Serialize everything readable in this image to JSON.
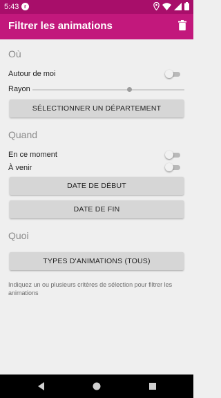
{
  "status_bar": {
    "time": "5:43",
    "icons": [
      "app-notification-icon",
      "location-icon",
      "wifi-icon",
      "signal-icon",
      "battery-icon"
    ]
  },
  "app_bar": {
    "title": "Filtrer les animations",
    "action_icon": "trash-icon"
  },
  "where": {
    "heading": "Où",
    "around_me_label": "Autour de moi",
    "around_me_on": false,
    "radius_label": "Rayon",
    "radius_value_fraction": 0.64,
    "department_button": "Sélectionner un département"
  },
  "when": {
    "heading": "Quand",
    "now_label": "En ce moment",
    "now_on": false,
    "upcoming_label": "À venir",
    "upcoming_on": false,
    "start_date_button": "Date de début",
    "end_date_button": "Date de fin"
  },
  "what": {
    "heading": "Quoi",
    "types_button": "Types d'animations (tous)"
  },
  "hint_text": "Indiquez un ou plusieurs critères de sélection pour filtrer les animations",
  "nav_bar": {
    "icons": [
      "back-icon",
      "home-icon",
      "recents-icon"
    ]
  },
  "colors": {
    "status_bar": "#a80e6a",
    "app_bar": "#c2187c",
    "background": "#efefef",
    "button": "#d6d6d6"
  }
}
